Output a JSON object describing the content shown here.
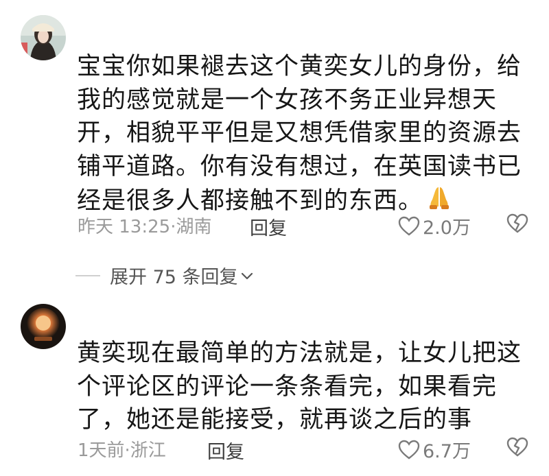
{
  "comments": [
    {
      "avatar_icon": "girl-avatar-icon",
      "text_lines": [
        "宝宝你如果褪去这个黄奕女儿的身份，给",
        "我的感觉就是一个女孩不务正业异想天",
        "开，相貌平平但是又想凭借家里的资源去",
        "铺平道路。你有没有想过，在英国读书已",
        "经是很多人都接触不到的东西。"
      ],
      "emoji_icon": "folded-hands-icon",
      "meta": "昨天 13:25·湖南",
      "reply_label": "回复",
      "likes": "2.0万"
    },
    {
      "avatar_icon": "glowing-lamp-avatar-icon",
      "text_lines": [
        "黄奕现在最简单的方法就是，让女儿把这",
        "个评论区的评论一条条看完，如果看完",
        "了，她还是能接受，就再谈之后的事"
      ],
      "meta": "1天前·浙江",
      "reply_label": "回复",
      "likes": "6.7万"
    }
  ],
  "expand_replies": {
    "label": "展开 75 条回复",
    "icon": "chevron-down-icon"
  },
  "colors": {
    "text": "#161616",
    "meta": "#9a9a9a",
    "icon": "#7a7a7a"
  }
}
